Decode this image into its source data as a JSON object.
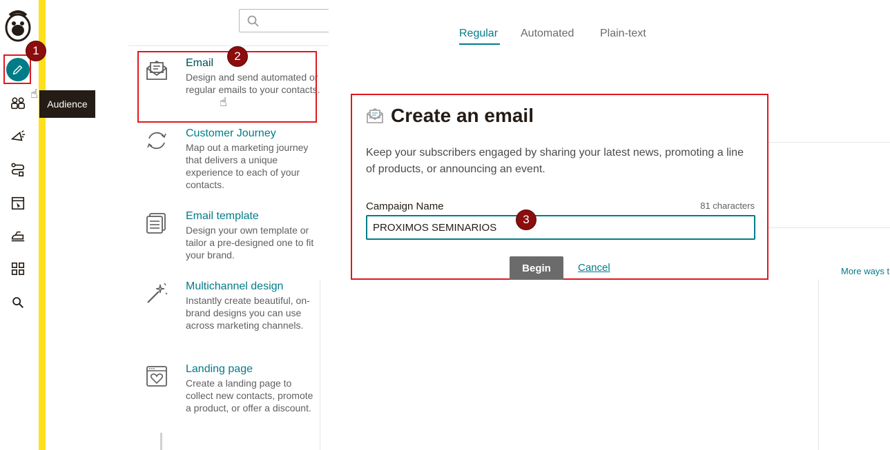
{
  "nav": {
    "tooltip": "Audience",
    "items": [
      "logo",
      "create",
      "audience",
      "campaigns",
      "automations",
      "website",
      "integrations",
      "content",
      "search"
    ]
  },
  "annotations": {
    "step1": "1",
    "step2": "2",
    "step3": "3"
  },
  "search": {
    "placeholder": ""
  },
  "menu": [
    {
      "title": "Email",
      "desc": "Design and send automated or regular emails to your contacts.",
      "icon": "email-icon"
    },
    {
      "title": "Customer Journey",
      "desc": "Map out a marketing journey that delivers a unique experience to each of your contacts.",
      "icon": "journey-icon"
    },
    {
      "title": "Email template",
      "desc": "Design your own template or tailor a pre-designed one to fit your brand.",
      "icon": "template-icon"
    },
    {
      "title": "Multichannel design",
      "desc": "Instantly create beautiful, on-brand designs you can use across marketing channels.",
      "icon": "magic-wand-icon"
    },
    {
      "title": "Landing page",
      "desc": "Create a landing page to collect new contacts, promote a product, or offer a discount.",
      "icon": "landing-page-icon"
    }
  ],
  "tabs": {
    "regular": "Regular",
    "automated": "Automated",
    "plain": "Plain-text"
  },
  "modal": {
    "title": "Create an email",
    "desc": "Keep your subscribers engaged by sharing your latest news, promoting a line of products, or announcing an event.",
    "field_label": "Campaign Name",
    "char_count": "81 characters",
    "campaign_name": "PROXIMOS SEMINARIOS",
    "begin": "Begin",
    "cancel": "Cancel"
  },
  "more_ways": "More ways t",
  "colors": {
    "accent": "#007c89",
    "highlight": "#e0171d",
    "badge": "#8b0d0d",
    "yellow": "#ffe01b"
  }
}
